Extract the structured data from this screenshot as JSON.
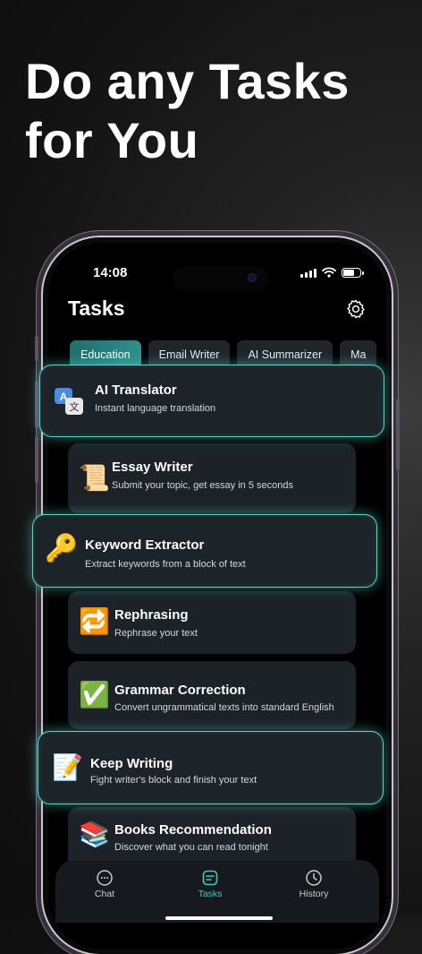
{
  "headline": {
    "line1": "Do any Tasks",
    "line2": "for You"
  },
  "status_bar": {
    "time": "14:08"
  },
  "header": {
    "title": "Tasks"
  },
  "chips": [
    {
      "label": "Education",
      "active": true
    },
    {
      "label": "Email Writer",
      "active": false
    },
    {
      "label": "AI Summarizer",
      "active": false
    },
    {
      "label": "Ma",
      "active": false
    }
  ],
  "tasks": [
    {
      "title": "AI Translator",
      "subtitle": "Instant language translation",
      "icon": "translate-icon",
      "highlighted": true
    },
    {
      "title": "Essay Writer",
      "subtitle": "Submit your topic, get essay in 5 seconds",
      "icon": "scroll-icon",
      "emoji": "📜",
      "highlighted": false
    },
    {
      "title": "Keyword Extractor",
      "subtitle": "Extract keywords from a block of text",
      "icon": "key-icon",
      "emoji": "🔑",
      "highlighted": true
    },
    {
      "title": "Rephrasing",
      "subtitle": "Rephrase your text",
      "icon": "repeat-icon",
      "emoji": "🔁",
      "highlighted": false
    },
    {
      "title": "Grammar Correction",
      "subtitle": "Convert ungrammatical texts into standard English",
      "icon": "check-mark-icon",
      "emoji": "✅",
      "highlighted": false
    },
    {
      "title": "Keep Writing",
      "subtitle": "Fight writer's block and finish your text",
      "icon": "memo-icon",
      "emoji": "📝",
      "highlighted": true
    },
    {
      "title": "Books Recommendation",
      "subtitle": "Discover what you can read tonight",
      "icon": "books-icon",
      "emoji": "📚",
      "highlighted": false
    }
  ],
  "tabbar": [
    {
      "label": "Chat",
      "icon": "chat-bubble-icon",
      "active": false
    },
    {
      "label": "Tasks",
      "icon": "tasks-icon",
      "active": true
    },
    {
      "label": "History",
      "icon": "clock-icon",
      "active": false
    }
  ],
  "colors": {
    "accent": "#47c8bf",
    "highlight_border": "#5fd6c8",
    "card_bg": "#1c2227",
    "chip_active": "#2f8f8d"
  }
}
